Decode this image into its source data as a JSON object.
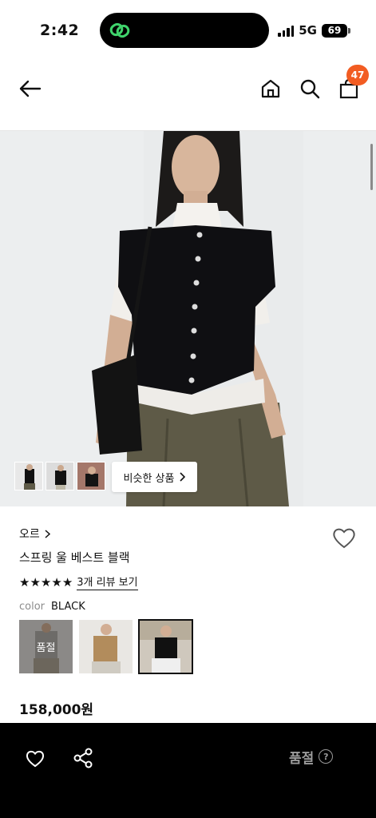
{
  "status_bar": {
    "time": "2:42",
    "network": "5G",
    "battery": "69"
  },
  "header": {
    "back_icon": "arrow-left-icon",
    "home_icon": "home-icon",
    "search_icon": "search-icon",
    "cart_icon": "shopping-bag-icon",
    "cart_badge": "47",
    "badge_color": "#f25c22"
  },
  "gallery": {
    "similar_button_label": "비슷한 상품"
  },
  "product": {
    "brand": "오르",
    "name": "스프링 울 베스트 블랙",
    "rating_stars": 5,
    "review_link": "3개 리뷰 보기",
    "color_label": "color",
    "color_value": "BLACK",
    "swatches": [
      {
        "sold_out_label": "품절",
        "selected": false
      },
      {
        "sold_out_label": "",
        "selected": false
      },
      {
        "sold_out_label": "",
        "selected": true
      }
    ],
    "price": "158,000원"
  },
  "bottom_bar": {
    "wishlist_icon": "heart-icon",
    "share_icon": "share-icon",
    "cta_label": "품절",
    "help_icon": "question-circle-icon",
    "help_glyph": "?"
  }
}
